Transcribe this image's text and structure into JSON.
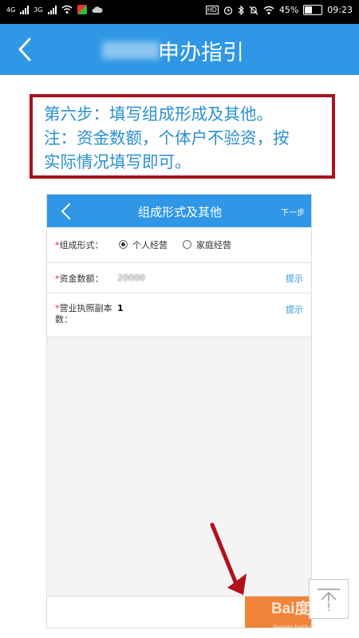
{
  "status_bar": {
    "network1": "4G",
    "network2": "3G",
    "hd": "HD",
    "battery_percent": "45%",
    "time": "09:23",
    "icons": [
      "signal-icon",
      "wifi-icon",
      "app-icon",
      "cloud-icon",
      "alarm-icon",
      "bluetooth-icon",
      "mute-icon",
      "wifi-icon",
      "battery-icon"
    ]
  },
  "header": {
    "title": "申办指引"
  },
  "note": {
    "lines": [
      "第六步：填写组成形成及其他。",
      "注：资金数额，个体户不验资，按",
      "实际情况填写即可。"
    ]
  },
  "inner_app": {
    "title": "组成形式及其他",
    "next_label": "下一步",
    "form": {
      "asterisk": "*",
      "composition_label": "组成形式：",
      "option1": "个人经营",
      "option2": "家庭经营",
      "capital_label": "资金数额：",
      "capital_value": "20000",
      "hint_label": "提示",
      "license_label_line1": "营业执照副本",
      "license_count": "1",
      "license_label_line2": "数："
    }
  },
  "watermark": {
    "text": "Bai度经验",
    "url": "jingyan.baidu.com"
  },
  "colors": {
    "primary_blue": "#2f97e6",
    "note_text": "#2a8fd0",
    "note_border": "#a8121c",
    "orange": "#f0853a",
    "arrow_red": "#b3101b"
  }
}
